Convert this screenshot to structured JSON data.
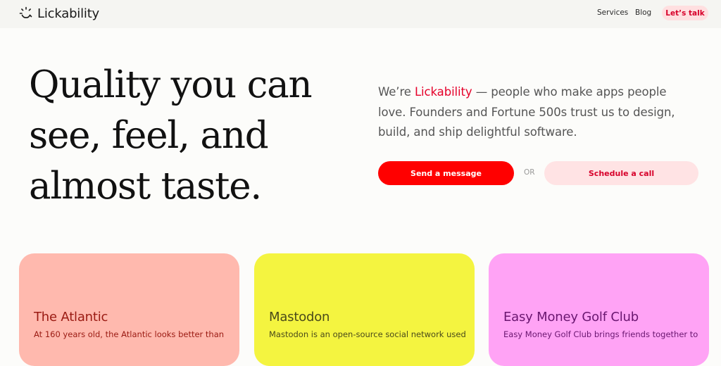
{
  "header": {
    "logo_text": "Lickability",
    "logo_icon": "sun-smile-icon",
    "nav": {
      "services": "Services",
      "blog": "Blog",
      "cta": "Let’s talk"
    }
  },
  "hero": {
    "title_lines": [
      "Quality you can",
      "see, feel, and",
      "almost taste."
    ],
    "intro_prefix": "We’re ",
    "intro_brand": "Lickability",
    "intro_suffix": " — people who make apps people love. Founders and Fortune 500s trust us to design, build, and ship delightful software.",
    "primary_button": "Send a message",
    "or_label": "OR",
    "secondary_button": "Schedule a call"
  },
  "cards": [
    {
      "title": "The Atlantic",
      "description": "At 160 years old, the Atlantic looks better than",
      "color": "#ffb9ae"
    },
    {
      "title": "Mastodon",
      "description": "Mastodon is an open-source social network used",
      "color": "#f4f440"
    },
    {
      "title": "Easy Money Golf Club",
      "description": "Easy Money Golf Club brings friends together to",
      "color": "#ffa3f5"
    }
  ],
  "colors": {
    "accent": "#ff0000",
    "brand_text": "#e5002a",
    "cta_background": "#ffdfe0"
  }
}
